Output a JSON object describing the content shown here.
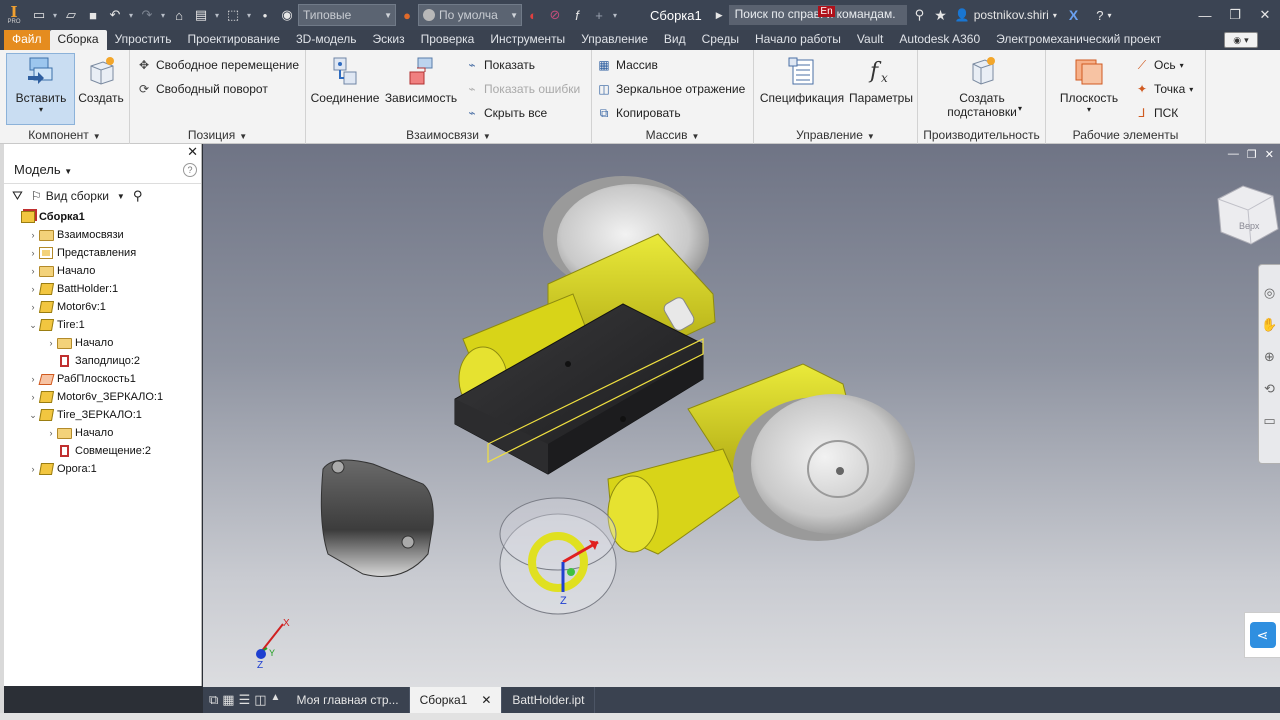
{
  "titlebar": {
    "app_logo": "I",
    "app_logo_sub": "PRO",
    "appearance_combo": "Типовые",
    "material_combo": "По умолча",
    "doc_title": "Сборка1",
    "search_placeholder": "Поиск по справ. и командам.",
    "lang_badge": "En",
    "user_name": "postnikov.shiri"
  },
  "menu_tabs": [
    "Файл",
    "Сборка",
    "Упростить",
    "Проектирование",
    "3D-модель",
    "Эскиз",
    "Проверка",
    "Инструменты",
    "Управление",
    "Вид",
    "Среды",
    "Начало работы",
    "Vault",
    "Autodesk A360",
    "Электромеханический проект"
  ],
  "ribbon": {
    "component": {
      "title": "Компонент",
      "insert": "Вставить",
      "create": "Создать"
    },
    "position": {
      "title": "Позиция",
      "free_move": "Свободное перемещение",
      "free_rotate": "Свободный поворот"
    },
    "relationships": {
      "title": "Взаимосвязи",
      "joint": "Соединение",
      "constrain": "Зависимость",
      "show": "Показать",
      "show_errors": "Показать ошибки",
      "hide_all": "Скрыть все"
    },
    "pattern": {
      "title": "Массив",
      "array": "Массив",
      "mirror": "Зеркальное отражение",
      "copy": "Копировать"
    },
    "manage": {
      "title": "Управление",
      "bom": "Спецификация",
      "parameters": "Параметры"
    },
    "productivity": {
      "title": "Производительность",
      "create_substitutes": "Создать подстановки"
    },
    "work_features": {
      "title": "Рабочие элементы",
      "plane": "Плоскость",
      "axis": "Ось",
      "point": "Точка",
      "ucs": "ПСК"
    }
  },
  "browser": {
    "title": "Модель",
    "view": "Вид сборки",
    "tree": [
      {
        "label": "Сборка1",
        "level": 0,
        "icon": "assembly-icon",
        "expand": "",
        "bold": true
      },
      {
        "label": "Взаимосвязи",
        "level": 1,
        "icon": "folder-icon",
        "expand": ">"
      },
      {
        "label": "Представления",
        "level": 1,
        "icon": "representations-icon",
        "expand": ">"
      },
      {
        "label": "Начало",
        "level": 1,
        "icon": "folder-icon",
        "expand": ">"
      },
      {
        "label": "BattHolder:1",
        "level": 1,
        "icon": "part-icon",
        "expand": ">"
      },
      {
        "label": "Motor6v:1",
        "level": 1,
        "icon": "part-icon",
        "expand": ">"
      },
      {
        "label": "Tire:1",
        "level": 1,
        "icon": "part-icon",
        "expand": "v"
      },
      {
        "label": "Начало",
        "level": 2,
        "icon": "folder-icon",
        "expand": ">"
      },
      {
        "label": "Заподлицо:2",
        "level": 2,
        "icon": "constraint-icon",
        "expand": ""
      },
      {
        "label": "РабПлоскость1",
        "level": 1,
        "icon": "work-plane-icon",
        "expand": ">"
      },
      {
        "label": "Motor6v_ЗЕРКАЛО:1",
        "level": 1,
        "icon": "part-icon",
        "expand": ">"
      },
      {
        "label": "Tire_ЗЕРКАЛО:1",
        "level": 1,
        "icon": "part-icon",
        "expand": "v"
      },
      {
        "label": "Начало",
        "level": 2,
        "icon": "folder-icon",
        "expand": ">"
      },
      {
        "label": "Совмещение:2",
        "level": 2,
        "icon": "constraint-icon",
        "expand": ""
      },
      {
        "label": "Opora:1",
        "level": 1,
        "icon": "part-icon",
        "expand": ">"
      }
    ]
  },
  "viewcube": {
    "face": "Верх"
  },
  "triad": {
    "x": "X",
    "y": "Y",
    "z": "Z"
  },
  "doc_tabs": [
    {
      "label": "Моя главная стр...",
      "active": false
    },
    {
      "label": "Сборка1",
      "active": true
    },
    {
      "label": "BattHolder.ipt",
      "active": false
    }
  ],
  "colors": {
    "accent": "#e58c1f",
    "part_yellow": "#d4d41a",
    "battery_black": "#2a2a2c",
    "tire_gray": "#cfcfcf"
  }
}
